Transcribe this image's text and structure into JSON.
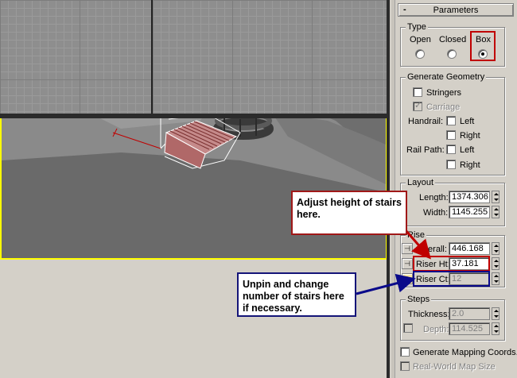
{
  "parameters": {
    "header": {
      "collapse_glyph": "-",
      "title": "Parameters"
    },
    "type": {
      "label": "Type",
      "options": [
        {
          "label": "Open",
          "selected": false
        },
        {
          "label": "Closed",
          "selected": false
        },
        {
          "label": "Box",
          "selected": true
        }
      ]
    },
    "generate_geometry": {
      "label": "Generate Geometry",
      "stringers": {
        "label": "Stringers",
        "checked": false
      },
      "carriage": {
        "label": "Carriage",
        "checked": true,
        "enabled": false
      },
      "handrail": {
        "label": "Handrail:",
        "left": "Left",
        "right": "Right"
      },
      "rail_path": {
        "label": "Rail Path:",
        "left": "Left",
        "right": "Right"
      }
    },
    "layout": {
      "label": "Layout",
      "length": {
        "label": "Length:",
        "value": "1374.306"
      },
      "width": {
        "label": "Width:",
        "value": "1145.255"
      }
    },
    "rise": {
      "label": "Rise",
      "overall": {
        "label": "Overall:",
        "value": "446.168"
      },
      "riser_ht": {
        "label": "Riser Ht:",
        "value": "37.181"
      },
      "riser_ct": {
        "label": "Riser Ct:",
        "value": "12"
      }
    },
    "steps": {
      "label": "Steps",
      "thickness": {
        "label": "Thickness:",
        "value": "2.0"
      },
      "depth": {
        "label": "Depth:",
        "value": "114.525"
      }
    },
    "generate_mapping": {
      "label": "Generate Mapping Coords."
    },
    "real_world": {
      "label": "Real-World Map Size"
    }
  },
  "callouts": {
    "riser_height": "Adjust height of stairs here.",
    "riser_count": "Unpin and change number of stairs here if necessary."
  },
  "colors": {
    "active_viewport": "#ffff00",
    "highlight_red": "#c00000",
    "highlight_blue": "#0a0a8a"
  }
}
